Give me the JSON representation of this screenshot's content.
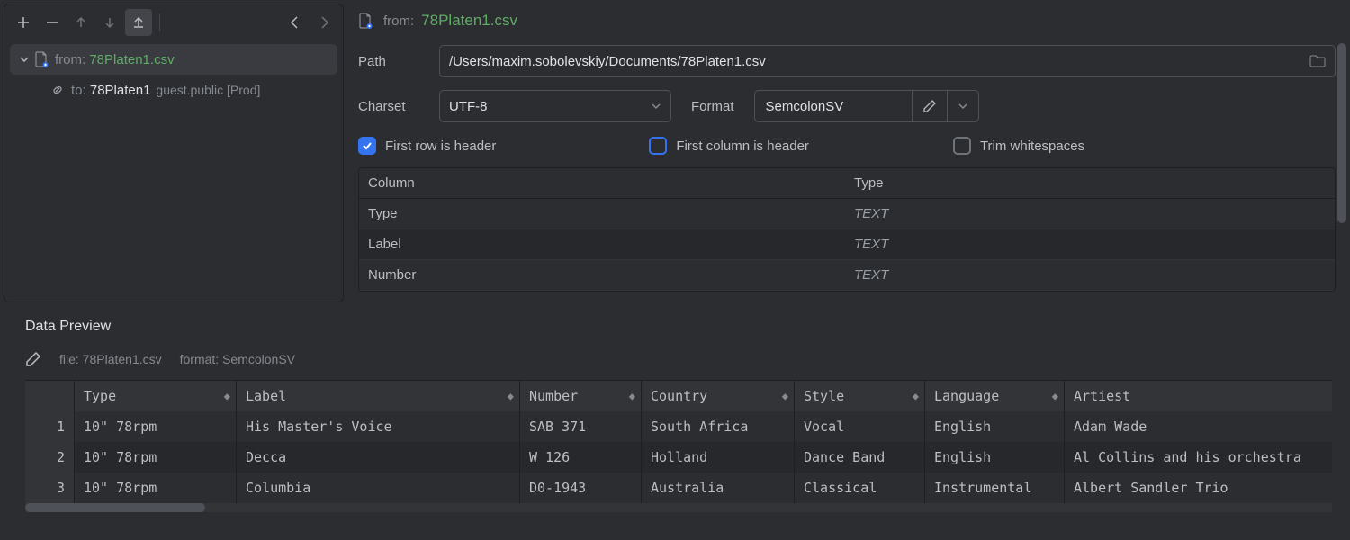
{
  "tree": {
    "from_prefix": "from:",
    "from_file": "78Platen1.csv",
    "to_prefix": "to:",
    "to_dest": "78Platen1",
    "to_meta": "guest.public [Prod]"
  },
  "source_header": {
    "prefix": "from:",
    "file": "78Platen1.csv"
  },
  "fields": {
    "path_label": "Path",
    "path_value": "/Users/maxim.sobolevskiy/Documents/78Platen1.csv",
    "charset_label": "Charset",
    "charset_value": "UTF-8",
    "format_label": "Format",
    "format_value": "SemcolonSV"
  },
  "checks": {
    "first_row_header": "First row is header",
    "first_col_header": "First column is header",
    "trim_ws": "Trim whitespaces"
  },
  "col_table": {
    "head_col": "Column",
    "head_type": "Type",
    "rows": [
      {
        "name": "Type",
        "type": "TEXT"
      },
      {
        "name": "Label",
        "type": "TEXT"
      },
      {
        "name": "Number",
        "type": "TEXT"
      }
    ]
  },
  "preview": {
    "title": "Data Preview",
    "file_meta": "file: 78Platen1.csv",
    "format_meta": "format: SemcolonSV",
    "columns": [
      "Type",
      "Label",
      "Number",
      "Country",
      "Style",
      "Language",
      "Artiest"
    ],
    "rows": [
      {
        "n": "1",
        "cells": [
          "10\" 78rpm",
          "His Master's Voice",
          "SAB 371",
          "South Africa",
          "Vocal",
          "English",
          "Adam Wade"
        ]
      },
      {
        "n": "2",
        "cells": [
          "10\" 78rpm",
          "Decca",
          "W 126",
          "Holland",
          "Dance Band",
          "English",
          "Al Collins and his orchestra"
        ]
      },
      {
        "n": "3",
        "cells": [
          "10\" 78rpm",
          "Columbia",
          "D0-1943",
          "Australia",
          "Classical",
          "Instrumental",
          "Albert Sandler Trio"
        ]
      }
    ]
  }
}
